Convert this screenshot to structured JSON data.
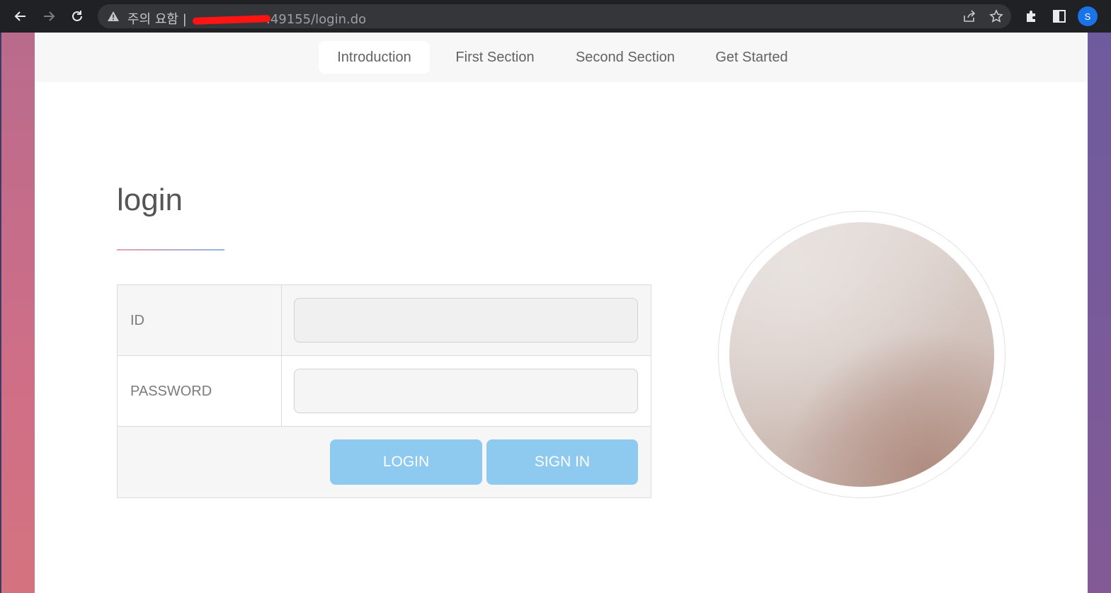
{
  "browser": {
    "warning_label": "주의 요함",
    "separator": "|",
    "url_visible": ":49155/login.do",
    "profile_initial": "S"
  },
  "nav": {
    "items": [
      {
        "label": "Introduction",
        "active": true
      },
      {
        "label": "First Section",
        "active": false
      },
      {
        "label": "Second Section",
        "active": false
      },
      {
        "label": "Get Started",
        "active": false
      }
    ]
  },
  "login": {
    "title": "login",
    "id_label": "ID",
    "id_value": "",
    "password_label": "PASSWORD",
    "password_value": "",
    "login_button": "LOGIN",
    "signin_button": "SIGN IN"
  },
  "colors": {
    "accent_button": "#8ec9f0",
    "chrome_bg": "#202124"
  }
}
